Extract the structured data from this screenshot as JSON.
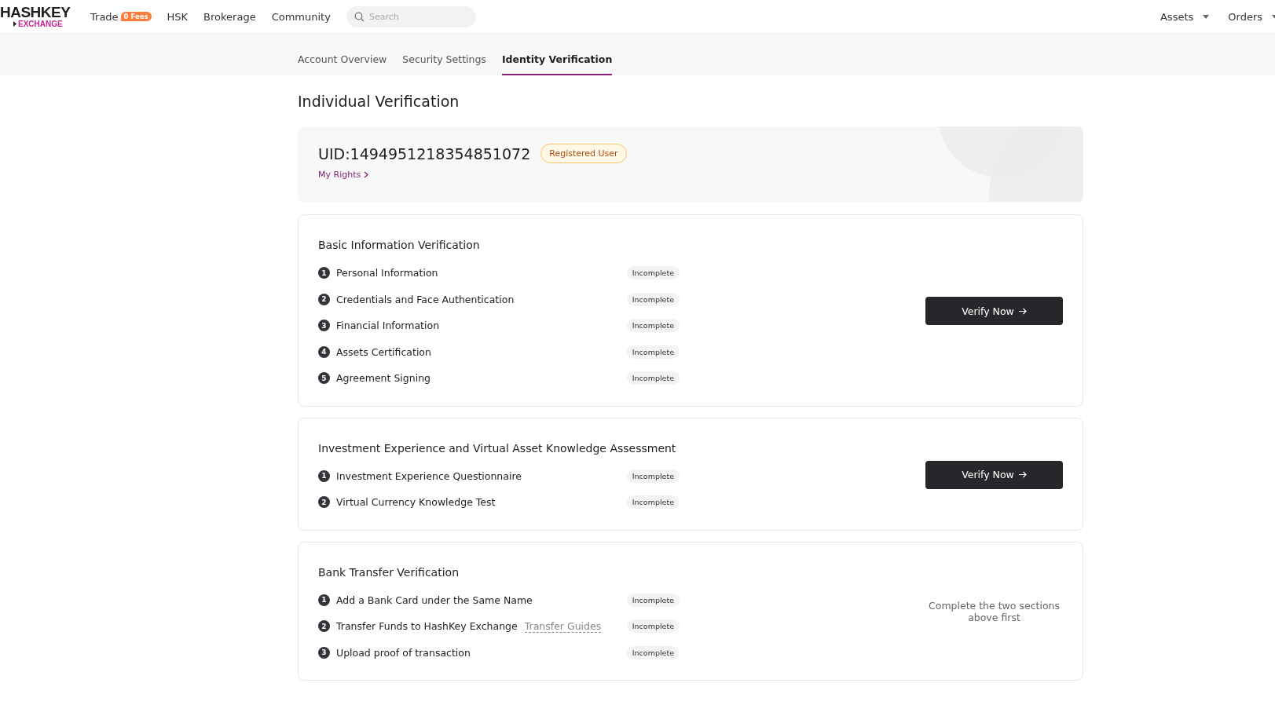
{
  "header": {
    "logo": {
      "title": "HASHKEY",
      "subtitle": "EXCHANGE"
    },
    "nav": [
      {
        "label": "Trade",
        "badge": "0 Fees"
      },
      {
        "label": "HSK"
      },
      {
        "label": "Brokerage"
      },
      {
        "label": "Community"
      }
    ],
    "search": {
      "placeholder": "Search"
    },
    "menus": [
      {
        "label": "Assets"
      },
      {
        "label": "Orders"
      }
    ]
  },
  "tabs": [
    {
      "label": "Account Overview",
      "selected": false
    },
    {
      "label": "Security Settings",
      "selected": false
    },
    {
      "label": "Identity Verification",
      "selected": true
    }
  ],
  "page_title": "Individual Verification",
  "account": {
    "uid": "UID:1494951218354851072",
    "badge": "Registered User",
    "link": "My Rights"
  },
  "sections": [
    {
      "title": "Basic Information Verification",
      "action": {
        "kind": "button",
        "label": "Verify Now"
      },
      "steps": [
        {
          "number": "1",
          "label": "Personal Information",
          "status": "Incomplete"
        },
        {
          "number": "2",
          "label": "Credentials and Face Authentication",
          "status": "Incomplete"
        },
        {
          "number": "3",
          "label": "Financial Information",
          "status": "Incomplete"
        },
        {
          "number": "4",
          "label": "Assets Certification",
          "status": "Incomplete"
        },
        {
          "number": "5",
          "label": "Agreement Signing",
          "status": "Incomplete"
        }
      ]
    },
    {
      "title": "Investment Experience and Virtual Asset Knowledge Assessment",
      "action": {
        "kind": "button",
        "label": "Verify Now"
      },
      "steps": [
        {
          "number": "1",
          "label": "Investment Experience Questionnaire",
          "status": "Incomplete"
        },
        {
          "number": "2",
          "label": "Virtual Currency Knowledge Test",
          "status": "Incomplete"
        }
      ]
    },
    {
      "title": "Bank Transfer Verification",
      "action": {
        "kind": "note",
        "label": "Complete the two sections above first"
      },
      "steps": [
        {
          "number": "1",
          "label": "Add a Bank Card under the Same Name",
          "status": "Incomplete"
        },
        {
          "number": "2",
          "label": "Transfer Funds to HashKey Exchange",
          "link": "Transfer Guides",
          "status": "Incomplete"
        },
        {
          "number": "3",
          "label": "Upload proof of transaction",
          "status": "Incomplete"
        }
      ]
    }
  ]
}
